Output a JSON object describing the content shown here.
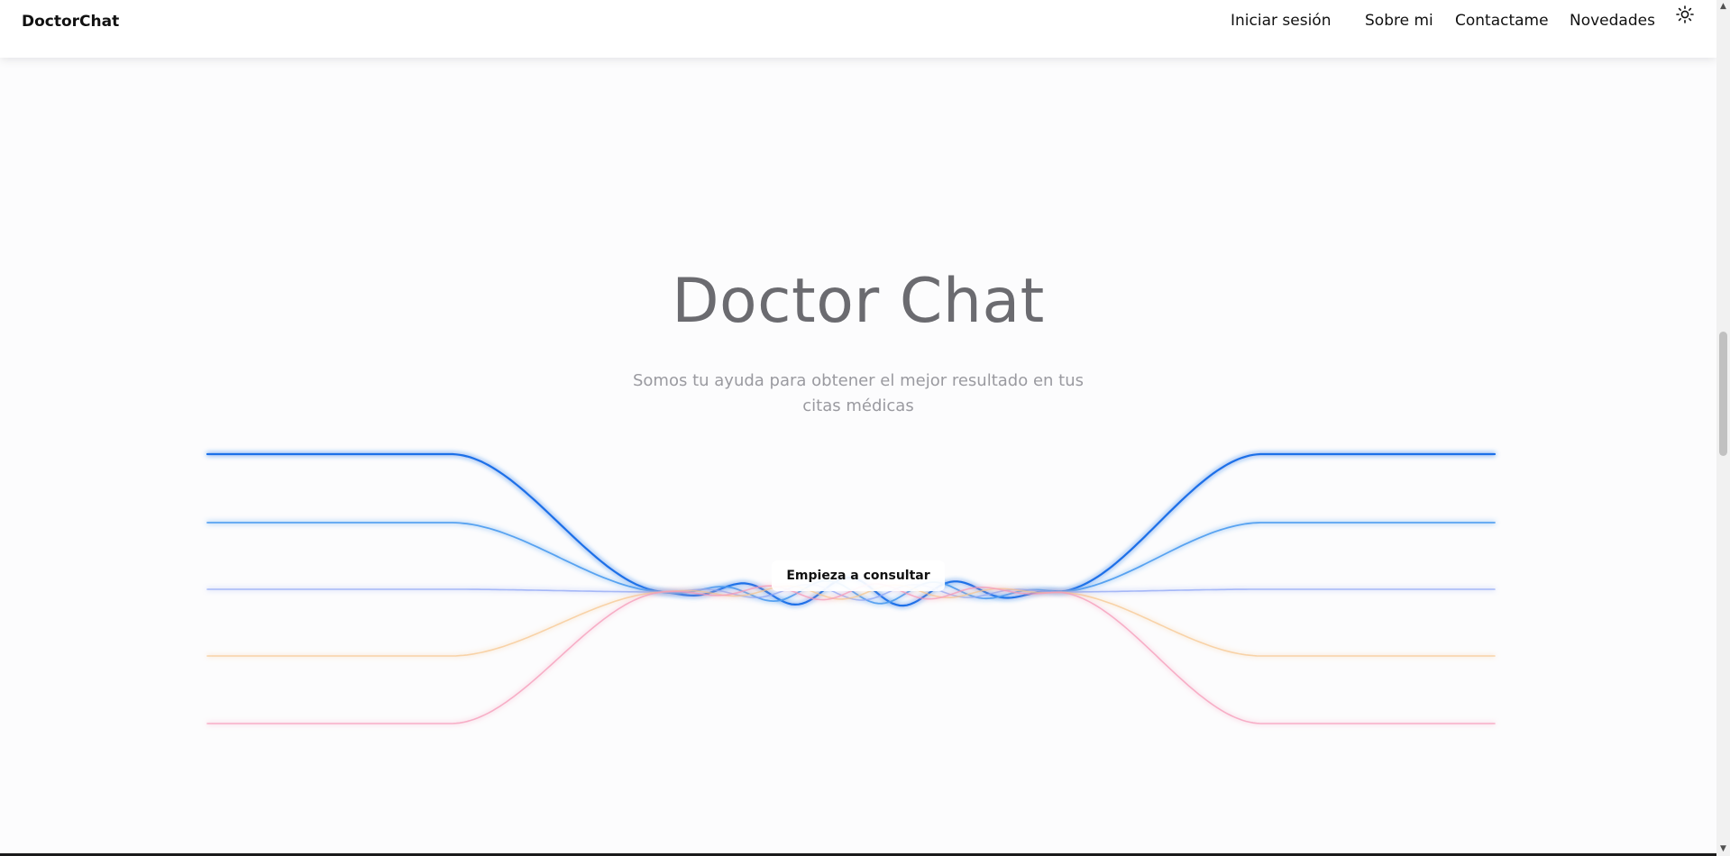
{
  "navbar": {
    "brand": "DoctorChat",
    "links": [
      {
        "label": "Iniciar sesión"
      },
      {
        "label": "Sobre mi"
      },
      {
        "label": "Contactame"
      },
      {
        "label": "Novedades"
      }
    ],
    "theme_icon": "sun-icon"
  },
  "hero": {
    "title": "Doctor Chat",
    "subtitle": "Somos tu ayuda para obtener el mejor resultado en tus citas médicas",
    "cta_label": "Empieza a consultar"
  },
  "colors": {
    "wave_blue_dark": "#1f6fe8",
    "wave_blue": "#4a9bf0",
    "wave_indigo": "#8fa6f5",
    "wave_orange": "#f7c48a",
    "wave_pink": "#f59ab8",
    "title": "#6b6b70",
    "subtitle": "#9a9aa0"
  },
  "scrollbar": {
    "up_icon": "scroll-up-arrow-icon",
    "down_icon": "scroll-down-arrow-icon"
  }
}
